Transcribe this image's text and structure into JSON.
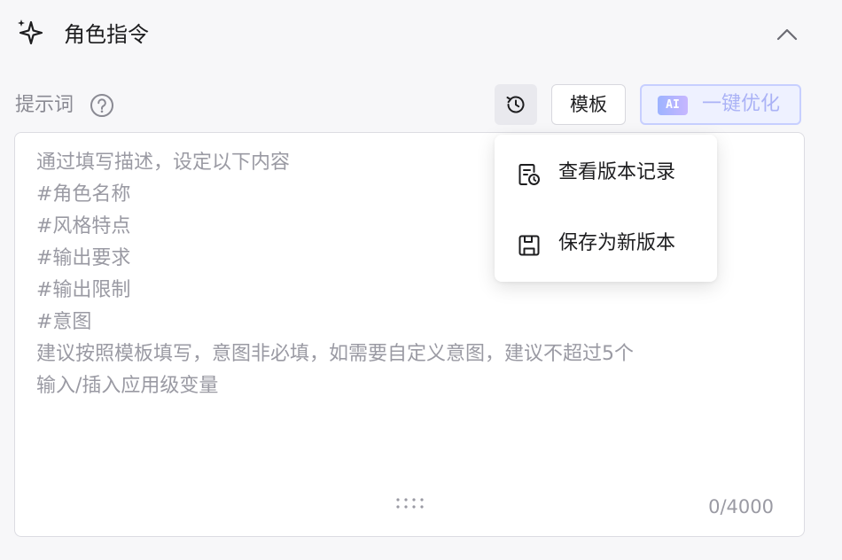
{
  "header": {
    "title": "角色指令",
    "icon": "sparkle-icon",
    "collapse_icon": "chevron-up-icon"
  },
  "prompt": {
    "label": "提示词",
    "help_icon": "question-circle-icon",
    "placeholder_lines": [
      "通过填写描述，设定以下内容",
      "#角色名称",
      "#风格特点",
      "#输出要求",
      "#输出限制",
      "#意图",
      "建议按照模板填写，意图非必填，如需要自定义意图，建议不超过5个",
      "输入/插入应用级变量"
    ],
    "counter": "0/4000"
  },
  "toolbar": {
    "history_icon": "history-icon",
    "template_label": "模板",
    "optimize_badge": "AI",
    "optimize_label": "一键优化"
  },
  "dropdown": {
    "items": [
      {
        "label": "查看版本记录",
        "icon": "document-history-icon"
      },
      {
        "label": "保存为新版本",
        "icon": "save-icon"
      }
    ]
  },
  "colors": {
    "accent_light": "#aab2f6",
    "placeholder": "#9a9aa3",
    "label": "#8a8a93"
  }
}
